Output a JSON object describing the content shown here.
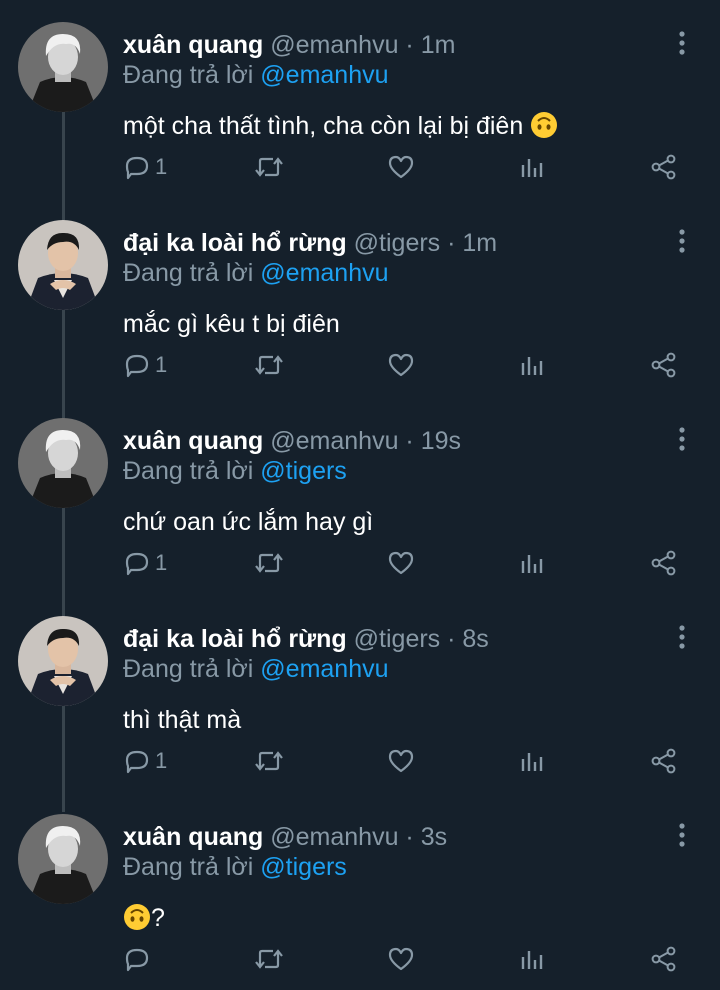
{
  "colors": {
    "background": "#15202b",
    "text": "#ffffff",
    "muted": "#8899a6",
    "link": "#1da1f2",
    "thread_line": "#38444d"
  },
  "tweets": [
    {
      "name": "xuân quang",
      "handle": "@emanhvu",
      "time": "1m",
      "reply_prefix": "Đang trả lời",
      "reply_to": "@emanhvu",
      "text": "một cha thất tình, cha còn lại bị điên",
      "emoji": "upside-down-face",
      "reply_count": "1",
      "avatar": "person-gray"
    },
    {
      "name": "đại ka loài hổ rừng",
      "handle": "@tigers",
      "time": "1m",
      "reply_prefix": "Đang trả lời",
      "reply_to": "@emanhvu",
      "text": "mắc gì kêu t bị điên",
      "emoji": "",
      "reply_count": "1",
      "avatar": "person-suit"
    },
    {
      "name": "xuân quang",
      "handle": "@emanhvu",
      "time": "19s",
      "reply_prefix": "Đang trả lời",
      "reply_to": "@tigers",
      "text": "chứ oan ức lắm hay gì",
      "emoji": "",
      "reply_count": "1",
      "avatar": "person-gray"
    },
    {
      "name": "đại ka loài hổ rừng",
      "handle": "@tigers",
      "time": "8s",
      "reply_prefix": "Đang trả lời",
      "reply_to": "@emanhvu",
      "text": "thì thật mà",
      "emoji": "",
      "reply_count": "1",
      "avatar": "person-suit"
    },
    {
      "name": "xuân quang",
      "handle": "@emanhvu",
      "time": "3s",
      "reply_prefix": "Đang trả lời",
      "reply_to": "@tigers",
      "text": "?",
      "emoji_before": "upside-down-face",
      "reply_count": "",
      "avatar": "person-gray"
    }
  ]
}
